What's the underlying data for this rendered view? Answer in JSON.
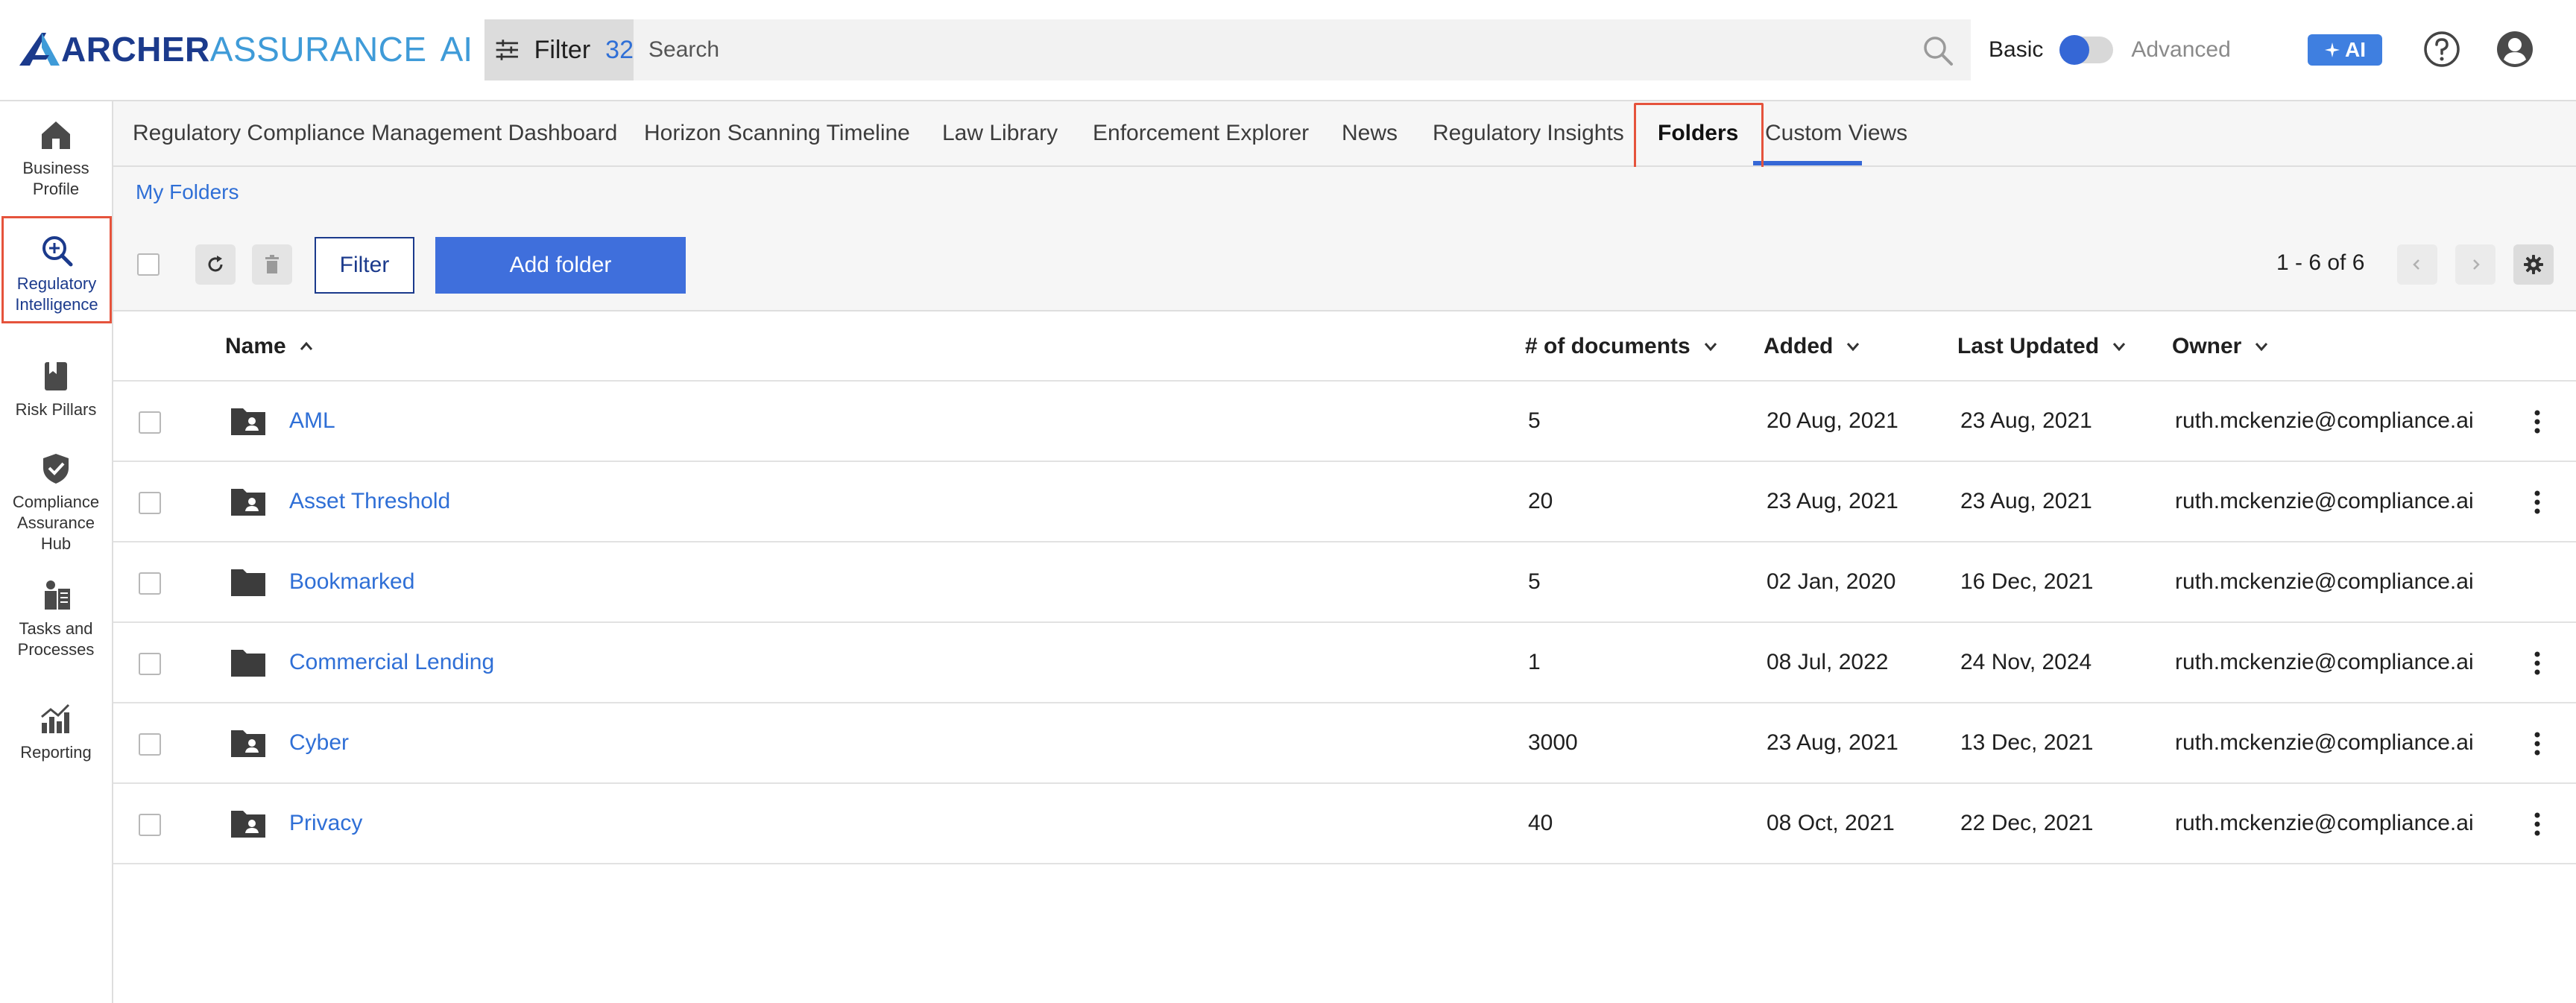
{
  "header": {
    "logo": {
      "word1": "ARCHER",
      "word2": "ASSURANCE",
      "word3": "AI"
    },
    "filter": {
      "label": "Filter",
      "count": "32"
    },
    "search": {
      "placeholder": "Search"
    },
    "mode": {
      "basic": "Basic",
      "advanced": "Advanced",
      "selected": "Basic"
    },
    "ai_button": "AI"
  },
  "sidebar": {
    "items": [
      {
        "label": "Business Profile",
        "icon": "home-icon",
        "active": false
      },
      {
        "label": "Regulatory Intelligence",
        "icon": "search-intel-icon",
        "active": true
      },
      {
        "label": "Risk Pillars",
        "icon": "book-icon",
        "active": false
      },
      {
        "label": "Compliance Assurance Hub",
        "icon": "shield-check-icon",
        "active": false
      },
      {
        "label": "Tasks and Processes",
        "icon": "tasks-icon",
        "active": false
      },
      {
        "label": "Reporting",
        "icon": "chart-icon",
        "active": false
      }
    ]
  },
  "tabs": [
    {
      "label": "Regulatory Compliance Management Dashboard"
    },
    {
      "label": "Horizon Scanning Timeline"
    },
    {
      "label": "Law Library"
    },
    {
      "label": "Enforcement Explorer"
    },
    {
      "label": "News"
    },
    {
      "label": "Regulatory Insights"
    },
    {
      "label": "Folders",
      "active": true
    },
    {
      "label": "Custom Views"
    }
  ],
  "breadcrumb": "My Folders",
  "toolbar": {
    "filter_label": "Filter",
    "add_label": "Add folder",
    "pager": "1 - 6 of 6"
  },
  "table": {
    "columns": [
      "Name",
      "# of documents",
      "Added",
      "Last Updated",
      "Owner"
    ],
    "rows": [
      {
        "name": "AML",
        "docs": "5",
        "added": "20 Aug, 2021",
        "updated": "23 Aug, 2021",
        "owner": "ruth.mckenzie@compliance.ai",
        "shared": true,
        "menu": true
      },
      {
        "name": "Asset Threshold",
        "docs": "20",
        "added": "23 Aug, 2021",
        "updated": "23 Aug, 2021",
        "owner": "ruth.mckenzie@compliance.ai",
        "shared": true,
        "menu": true
      },
      {
        "name": "Bookmarked",
        "docs": "5",
        "added": "02 Jan, 2020",
        "updated": "16 Dec, 2021",
        "owner": "ruth.mckenzie@compliance.ai",
        "shared": false,
        "menu": false
      },
      {
        "name": "Commercial Lending",
        "docs": "1",
        "added": "08 Jul, 2022",
        "updated": "24 Nov, 2024",
        "owner": "ruth.mckenzie@compliance.ai",
        "shared": false,
        "menu": true
      },
      {
        "name": "Cyber",
        "docs": "3000",
        "added": "23 Aug, 2021",
        "updated": "13 Dec, 2021",
        "owner": "ruth.mckenzie@compliance.ai",
        "shared": true,
        "menu": true
      },
      {
        "name": "Privacy",
        "docs": "40",
        "added": "08 Oct, 2021",
        "updated": "22 Dec, 2021",
        "owner": "ruth.mckenzie@compliance.ai",
        "shared": true,
        "menu": true
      }
    ]
  },
  "colors": {
    "accent": "#3f6fdc",
    "link": "#2f6fd6",
    "highlight": "#e5533c",
    "brand_dark": "#1b3a8c",
    "brand_light": "#3f9bd8"
  }
}
